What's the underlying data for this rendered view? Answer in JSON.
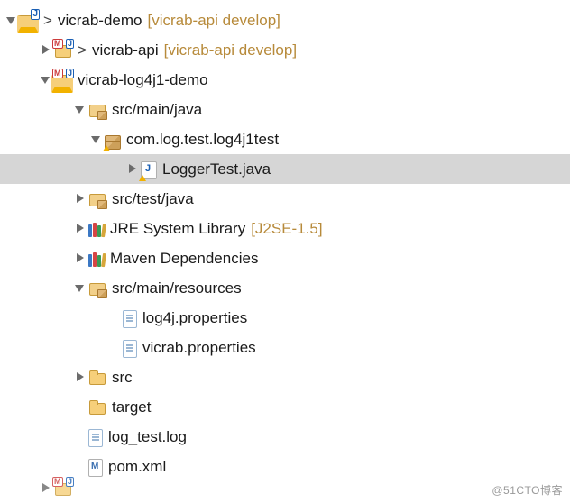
{
  "watermark": "@51CTO博客",
  "tree": {
    "root": {
      "label": "vicrab-demo",
      "hint": "[vicrab-api develop]"
    },
    "api": {
      "label": "vicrab-api",
      "hint": "[vicrab-api develop]"
    },
    "log4j1": {
      "label": "vicrab-log4j1-demo"
    },
    "src_main_java": {
      "label": "src/main/java"
    },
    "pkg": {
      "label": "com.log.test.log4j1test"
    },
    "java_file": {
      "label": "LoggerTest.java"
    },
    "src_test_java": {
      "label": "src/test/java"
    },
    "jre": {
      "label": "JRE System Library",
      "hint": "[J2SE-1.5]"
    },
    "maven_deps": {
      "label": "Maven Dependencies"
    },
    "src_main_res": {
      "label": "src/main/resources"
    },
    "res1": {
      "label": "log4j.properties"
    },
    "res2": {
      "label": "vicrab.properties"
    },
    "src_folder": {
      "label": "src"
    },
    "target": {
      "label": "target"
    },
    "logfile": {
      "label": "log_test.log"
    },
    "pom": {
      "label": "pom.xml"
    }
  }
}
